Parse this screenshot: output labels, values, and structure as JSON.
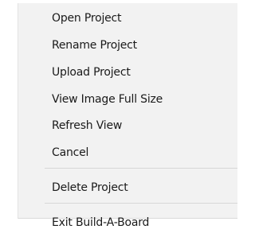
{
  "context_menu": {
    "items": [
      {
        "label": "Open Project"
      },
      {
        "label": "Rename Project"
      },
      {
        "label": "Upload Project"
      },
      {
        "label": "View Image Full Size"
      },
      {
        "label": "Refresh View"
      },
      {
        "label": "Cancel"
      },
      {
        "label": "Delete Project"
      },
      {
        "label": "Exit Build-A-Board"
      }
    ]
  }
}
